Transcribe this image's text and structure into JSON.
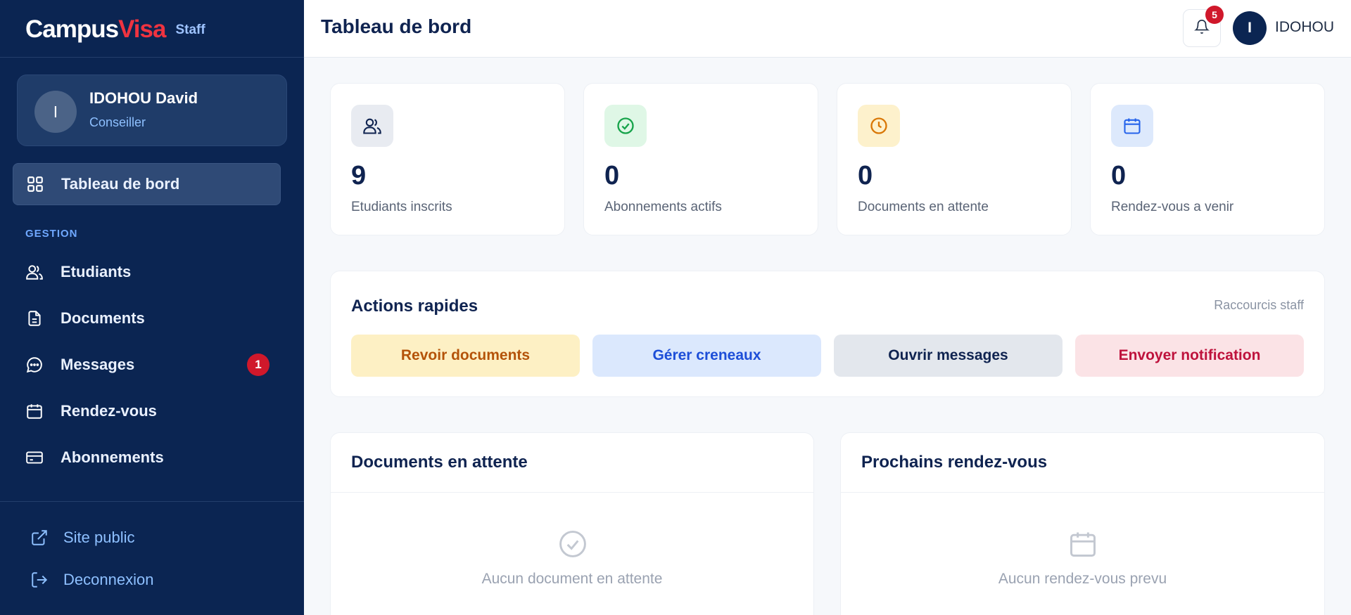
{
  "brand": {
    "name_part1": "Campus",
    "name_part2": "Visa",
    "tag": "Staff"
  },
  "profile": {
    "initial": "I",
    "name": "IDOHOU David",
    "role": "Conseiller"
  },
  "nav": {
    "dashboard": "Tableau de bord",
    "section_label": "GESTION",
    "items": [
      {
        "label": "Etudiants",
        "icon": "users-icon"
      },
      {
        "label": "Documents",
        "icon": "document-icon"
      },
      {
        "label": "Messages",
        "icon": "chat-icon",
        "badge": "1"
      },
      {
        "label": "Rendez-vous",
        "icon": "calendar-icon"
      },
      {
        "label": "Abonnements",
        "icon": "credit-card-icon"
      }
    ],
    "footer": [
      {
        "label": "Site public",
        "icon": "external-link-icon"
      },
      {
        "label": "Deconnexion",
        "icon": "logout-icon"
      }
    ]
  },
  "header": {
    "title": "Tableau de bord",
    "notifications_count": "5",
    "user_initial": "I",
    "user_name": "IDOHOU"
  },
  "stats": [
    {
      "value": "9",
      "label": "Etudiants inscrits",
      "icon": "users-icon",
      "color": "#e8ebf1"
    },
    {
      "value": "0",
      "label": "Abonnements actifs",
      "icon": "check-circle-icon",
      "color": "#dff7e6"
    },
    {
      "value": "0",
      "label": "Documents en attente",
      "icon": "clock-icon",
      "color": "#fdf1cc"
    },
    {
      "value": "0",
      "label": "Rendez-vous a venir",
      "icon": "calendar-icon",
      "color": "#dde9fc"
    }
  ],
  "actions": {
    "title": "Actions rapides",
    "subtitle": "Raccourcis staff",
    "buttons": [
      {
        "label": "Revoir documents",
        "bg": "#fdf0c4",
        "fg": "#b45309"
      },
      {
        "label": "Gérer creneaux",
        "bg": "#dbe8fd",
        "fg": "#1d4ed8"
      },
      {
        "label": "Ouvrir messages",
        "bg": "#e3e7ed",
        "fg": "#0f2350"
      },
      {
        "label": "Envoyer notification",
        "bg": "#fbe3e6",
        "fg": "#be123c"
      }
    ]
  },
  "panels": [
    {
      "title": "Documents en attente",
      "empty_text": "Aucun document en attente",
      "icon": "check-circle-icon"
    },
    {
      "title": "Prochains rendez-vous",
      "empty_text": "Aucun rendez-vous prevu",
      "icon": "calendar-icon"
    }
  ]
}
